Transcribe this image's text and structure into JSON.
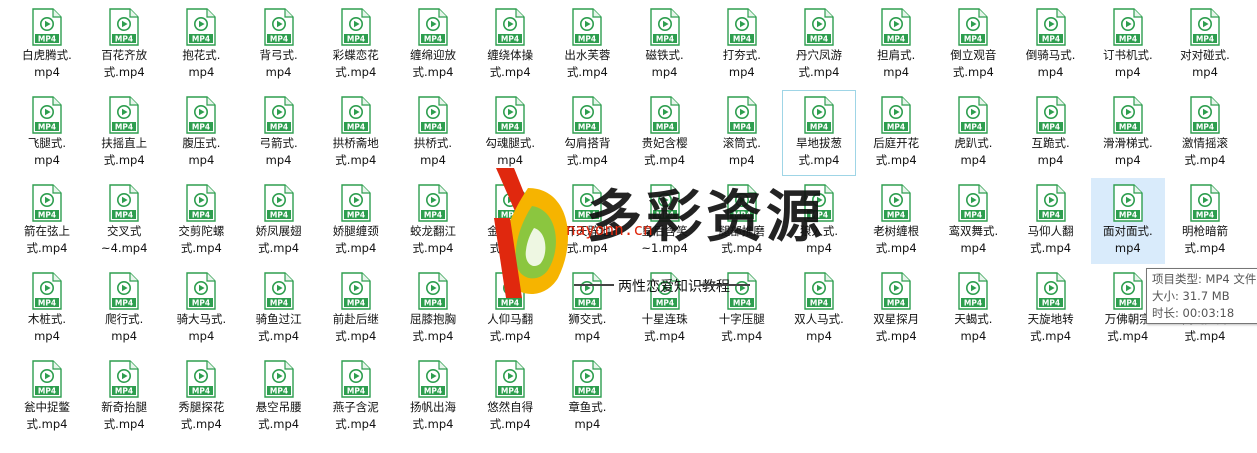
{
  "file_type_label": "MP4",
  "icon": "mp4-video-file-icon",
  "colors": {
    "icon_green": "#2e9e4f",
    "selected_bg": "#d9ebfb",
    "hover_border": "#9fd5e6"
  },
  "files": [
    [
      "白虎腾式.",
      "mp4"
    ],
    [
      "百花齐放",
      "式.mp4"
    ],
    [
      "抱花式.",
      "mp4"
    ],
    [
      "背弓式.",
      "mp4"
    ],
    [
      "彩蝶恋花",
      "式.mp4"
    ],
    [
      "缠绵迎放",
      "式.mp4"
    ],
    [
      "缠绕体操",
      "式.mp4"
    ],
    [
      "出水芙蓉",
      "式.mp4"
    ],
    [
      "磁铁式.",
      "mp4"
    ],
    [
      "打夯式.",
      "mp4"
    ],
    [
      "丹穴凤游",
      "式.mp4"
    ],
    [
      "担肩式.",
      "mp4"
    ],
    [
      "倒立观音",
      "式.mp4"
    ],
    [
      "倒骑马式.",
      "mp4"
    ],
    [
      "订书机式.",
      "mp4"
    ],
    [
      "对对碰式.",
      "mp4"
    ],
    [
      "飞腿式.",
      "mp4"
    ],
    [
      "扶摇直上",
      "式.mp4"
    ],
    [
      "腹压式.",
      "mp4"
    ],
    [
      "弓箭式.",
      "mp4"
    ],
    [
      "拱桥斋地",
      "式.mp4"
    ],
    [
      "拱桥式.",
      "mp4"
    ],
    [
      "勾魂腿式.",
      "mp4"
    ],
    [
      "勾肩搭背",
      "式.mp4"
    ],
    [
      "贵妃含樱",
      "式.mp4"
    ],
    [
      "滚筒式.",
      "mp4"
    ],
    [
      "旱地拔葱",
      "式.mp4"
    ],
    [
      "后庭开花",
      "式.mp4"
    ],
    [
      "虎趴式.",
      "mp4"
    ],
    [
      "互跪式.",
      "mp4"
    ],
    [
      "滑滑梯式.",
      "mp4"
    ],
    [
      "激情摇滚",
      "式.mp4"
    ],
    [
      "箭在弦上",
      "式.mp4"
    ],
    [
      "交叉式",
      "~4.mp4"
    ],
    [
      "交剪陀螺",
      "式.mp4"
    ],
    [
      "娇凤展翅",
      "式.mp4"
    ],
    [
      "娇腿缠颈",
      "式.mp4"
    ],
    [
      "蛟龙翻江",
      "式.mp4"
    ],
    [
      "金鸡独立",
      "式.mp4"
    ],
    [
      "开天辟地",
      "式.mp4"
    ],
    [
      "皇后含笑",
      "~1.mp4"
    ],
    [
      "腿部推磨",
      "式.mp4"
    ],
    [
      "狼入式.",
      "mp4"
    ],
    [
      "老树缠根",
      "式.mp4"
    ],
    [
      "鸾双舞式.",
      "mp4"
    ],
    [
      "马仰人翻",
      "式.mp4"
    ],
    [
      "面对面式.",
      "mp4"
    ],
    [
      "明枪暗箭",
      "式.mp4"
    ],
    [
      "木桩式.",
      "mp4"
    ],
    [
      "爬行式.",
      "mp4"
    ],
    [
      "骑大马式.",
      "mp4"
    ],
    [
      "骑鱼过江",
      "式.mp4"
    ],
    [
      "前赴后继",
      "式.mp4"
    ],
    [
      "屈膝抱胸",
      "式.mp4"
    ],
    [
      "人仰马翻",
      "式.mp4"
    ],
    [
      "狮交式.",
      "mp4"
    ],
    [
      "十星连珠",
      "式.mp4"
    ],
    [
      "十字压腿",
      "式.mp4"
    ],
    [
      "双人马式.",
      "mp4"
    ],
    [
      "双星探月",
      "式.mp4"
    ],
    [
      "天蝎式.",
      "mp4"
    ],
    [
      "天旋地转",
      "式.mp4"
    ],
    [
      "万佛朝宗",
      "式.mp4"
    ],
    [
      "闻鸡起舞",
      "式.mp4"
    ],
    [
      "瓮中捉鳖",
      "式.mp4"
    ],
    [
      "新奇抬腿",
      "式.mp4"
    ],
    [
      "秀腿探花",
      "式.mp4"
    ],
    [
      "悬空吊腰",
      "式.mp4"
    ],
    [
      "燕子含泥",
      "式.mp4"
    ],
    [
      "扬帆出海",
      "式.mp4"
    ],
    [
      "悠然自得",
      "式.mp4"
    ],
    [
      "章鱼式.",
      "mp4"
    ]
  ],
  "tooltip": {
    "type": "项目类型: MP4 文件",
    "size": "大小: 31.7 MB",
    "duration": "时长: 00:03:18"
  },
  "watermark": {
    "title": "多彩资源",
    "url": "nayonn.cn",
    "subtitle": "两性恋爱知识教程"
  }
}
